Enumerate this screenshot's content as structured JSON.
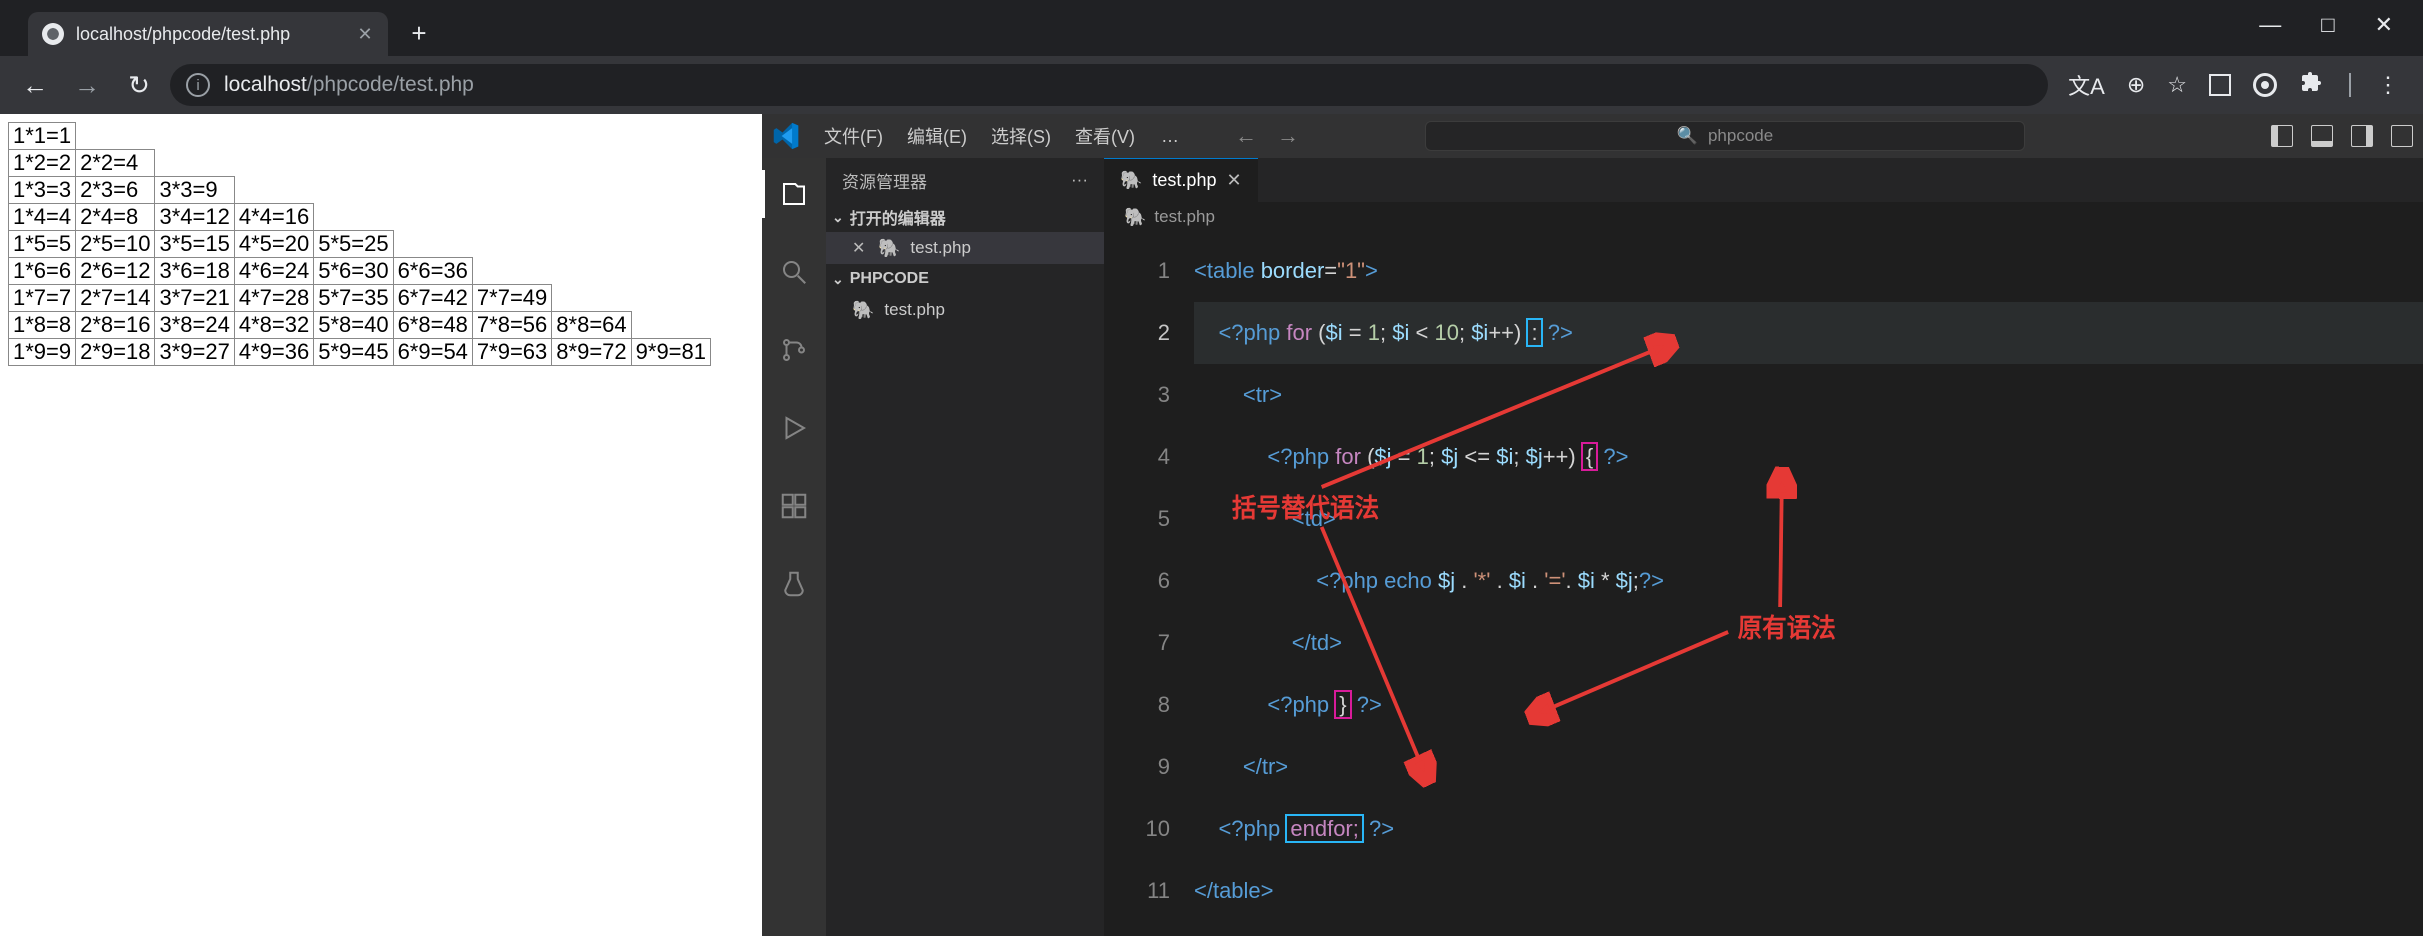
{
  "browser": {
    "tab_title": "localhost/phpcode/test.php",
    "url_host": "localhost",
    "url_path": "/phpcode/test.php",
    "newtab": "+",
    "window_min": "—",
    "window_max": "□",
    "window_close": "✕"
  },
  "toolbar_icons": {
    "back": "←",
    "forward": "→",
    "reload": "↻",
    "translate": "文A",
    "zoom": "⊕",
    "star": "☆",
    "menu": "⋮"
  },
  "mult_table": [
    [
      "1*1=1"
    ],
    [
      "1*2=2",
      "2*2=4"
    ],
    [
      "1*3=3",
      "2*3=6",
      "3*3=9"
    ],
    [
      "1*4=4",
      "2*4=8",
      "3*4=12",
      "4*4=16"
    ],
    [
      "1*5=5",
      "2*5=10",
      "3*5=15",
      "4*5=20",
      "5*5=25"
    ],
    [
      "1*6=6",
      "2*6=12",
      "3*6=18",
      "4*6=24",
      "5*6=30",
      "6*6=36"
    ],
    [
      "1*7=7",
      "2*7=14",
      "3*7=21",
      "4*7=28",
      "5*7=35",
      "6*7=42",
      "7*7=49"
    ],
    [
      "1*8=8",
      "2*8=16",
      "3*8=24",
      "4*8=32",
      "5*8=40",
      "6*8=48",
      "7*8=56",
      "8*8=64"
    ],
    [
      "1*9=9",
      "2*9=18",
      "3*9=27",
      "4*9=36",
      "5*9=45",
      "6*9=54",
      "7*9=63",
      "8*9=72",
      "9*9=81"
    ]
  ],
  "vscode": {
    "menus": [
      "文件(F)",
      "编辑(E)",
      "选择(S)",
      "查看(V)"
    ],
    "menu_more": "…",
    "search_placeholder": "phpcode",
    "sidebar_title": "资源管理器",
    "sidebar_more": "···",
    "open_editors": "打开的编辑器",
    "folder_name": "PHPCODE",
    "file_name": "test.php",
    "editor_tab": "test.php",
    "breadcrumb": "test.php",
    "line_numbers": [
      "1",
      "2",
      "3",
      "4",
      "5",
      "6",
      "7",
      "8",
      "9",
      "10",
      "11"
    ],
    "current_line_index": 1,
    "code_lines": {
      "l1_table_open": "<table border=\"1\">",
      "l2": {
        "php_open": "<?php",
        "for": "for",
        "body": "($i = 1; $i < 10; $i++)",
        "colon": ":",
        "php_close": "?>"
      },
      "l3": "<tr>",
      "l4": {
        "php_open": "<?php",
        "for": "for",
        "body": "($j = 1; $j <= $i; $j++)",
        "brace": "{",
        "php_close": "?>"
      },
      "l5": "<td>",
      "l6": {
        "php_open": "<?php",
        "echo": "echo",
        "expr": "$j . '*' . $i . '='. $i * $j;",
        "php_close": "?>"
      },
      "l7": "</td>",
      "l8": {
        "php_open": "<?php",
        "brace": "}",
        "php_close": "?>"
      },
      "l9": "</tr>",
      "l10": {
        "php_open": "<?php",
        "endfor": "endfor;",
        "php_close": "?>"
      },
      "l11": "</table>"
    },
    "annotations": {
      "alt_syntax": "括号替代语法",
      "orig_syntax": "原有语法"
    }
  }
}
